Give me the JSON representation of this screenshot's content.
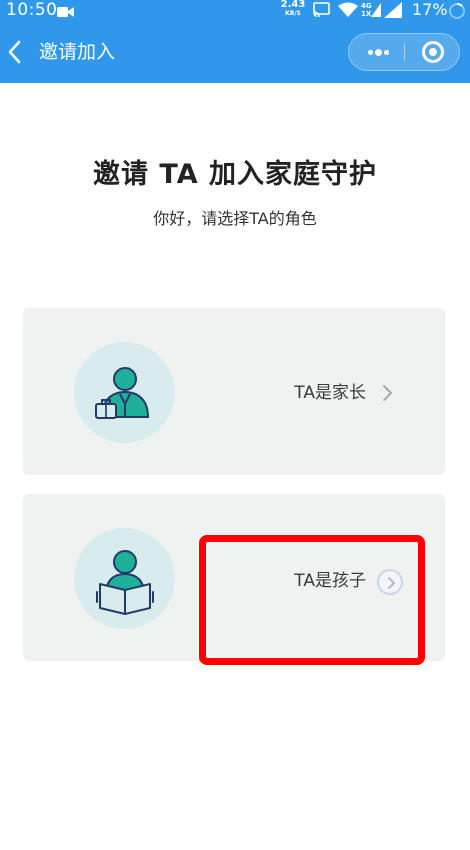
{
  "status_bar": {
    "time": "10:50",
    "net_rate": "2.43",
    "net_unit": "KB/S",
    "network_type": "4G",
    "network_sub": "1X",
    "battery": "17%"
  },
  "nav": {
    "title": "邀请加入"
  },
  "invite": {
    "title": "邀请 TA 加入家庭守护",
    "subtitle": "你好，请选择TA的角色"
  },
  "roles": [
    {
      "label": "TA是家长",
      "icon": "parent-avatar-icon"
    },
    {
      "label": "TA是孩子",
      "icon": "child-avatar-icon"
    }
  ],
  "colors": {
    "header_blue": "#2f98ea",
    "card_background": "#f0f2f2",
    "avatar_circle": "#d8eced",
    "avatar_teal": "#1fb09c",
    "avatar_navy": "#213a69",
    "highlight_red": "#ff0000"
  }
}
